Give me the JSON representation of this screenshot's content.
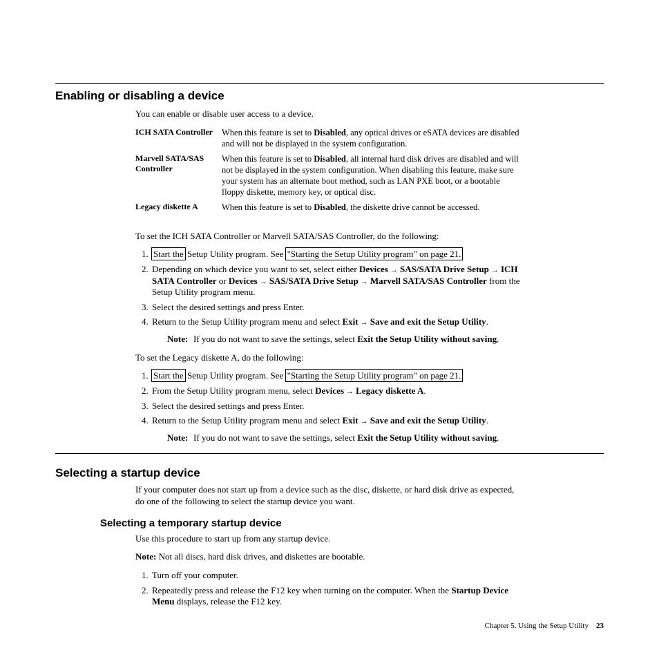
{
  "section1": {
    "heading": "Enabling or disabling a device",
    "intro": "You can enable or disable user access to a device.",
    "defs": [
      {
        "term": "ICH SATA Controller",
        "before": "When this feature is set to ",
        "bold": "Disabled",
        "after": ", any optical drives or eSATA devices are disabled and will not be displayed in the system configuration."
      },
      {
        "term": "Marvell SATA/SAS Controller",
        "before": "When this feature is set to ",
        "bold": "Disabled",
        "after": ", all internal hard disk drives are disabled and will not be displayed in the system configuration. When disabling this feature, make sure your system has an alternate boot method, such as LAN PXE boot, or a bootable floppy diskette, memory key, or optical disc."
      },
      {
        "term": "Legacy diskette A",
        "before": "When this feature is set to ",
        "bold": "Disabled",
        "after": ", the diskette drive cannot be accessed."
      }
    ],
    "lead1": "To set the ICH SATA Controller or Marvell SATA/SAS Controller, do the following:",
    "stepsA": {
      "s1a": "Start the",
      "s1b": " Setup Utility program. See ",
      "s1link": "\"Starting the Setup Utility program\" on page 21.",
      "s2": {
        "a": "Depending on which device you want to set, select either ",
        "b": "Devices",
        "c": " SAS/SATA Drive Setup",
        "d": " ICH SATA Controller",
        "e": " or ",
        "f": "Devices",
        "g": " SAS/SATA Drive Setup",
        "h": " Marvell SATA/SAS Controller",
        "i": " from the Setup Utility program menu."
      },
      "s3": "Select the desired settings and press Enter.",
      "s4a": "Return to the Setup Utility program menu and select ",
      "s4b": "Exit",
      "s4c": " Save and exit the Setup Utility",
      "s4d": "."
    },
    "noteA": {
      "label": "Note:",
      "t1": "If you do not want to save the settings, select ",
      "t2": "Exit the Setup Utility without saving",
      "t3": "."
    },
    "lead2": "To set the Legacy diskette A, do the following:",
    "stepsB": {
      "s1a": "Start the",
      "s1b": " Setup Utility program. See ",
      "s1link": "\"Starting the Setup Utility program\" on page 21.",
      "s2a": "From the Setup Utility program menu, select ",
      "s2b": "Devices",
      "s2c": " Legacy diskette A",
      "s2d": ".",
      "s3": "Select the desired settings and press Enter.",
      "s4a": "Return to the Setup Utility program menu and select ",
      "s4b": "Exit",
      "s4c": " Save and exit the Setup Utility",
      "s4d": "."
    },
    "noteB": {
      "label": "Note:",
      "t1": "If you do not want to save the settings, select ",
      "t2": "Exit the Setup Utility without saving",
      "t3": "."
    }
  },
  "section2": {
    "heading": "Selecting a startup device",
    "intro": "If your computer does not start up from a device such as the disc, diskette, or hard disk drive as expected, do one of the following to select the startup device you want."
  },
  "section3": {
    "heading": "Selecting a temporary startup device",
    "intro": "Use this procedure to start up from any startup device.",
    "noteLabel": "Note:",
    "noteText": " Not all discs, hard disk drives, and diskettes are bootable.",
    "steps": {
      "s1": "Turn off your computer.",
      "s2a": "Repeatedly press and release the F12 key when turning on the computer. When the ",
      "s2b": "Startup Device Menu",
      "s2c": " displays, release the F12 key."
    }
  },
  "footer": {
    "chapter": "Chapter 5. Using the Setup Utility",
    "page": "23"
  }
}
